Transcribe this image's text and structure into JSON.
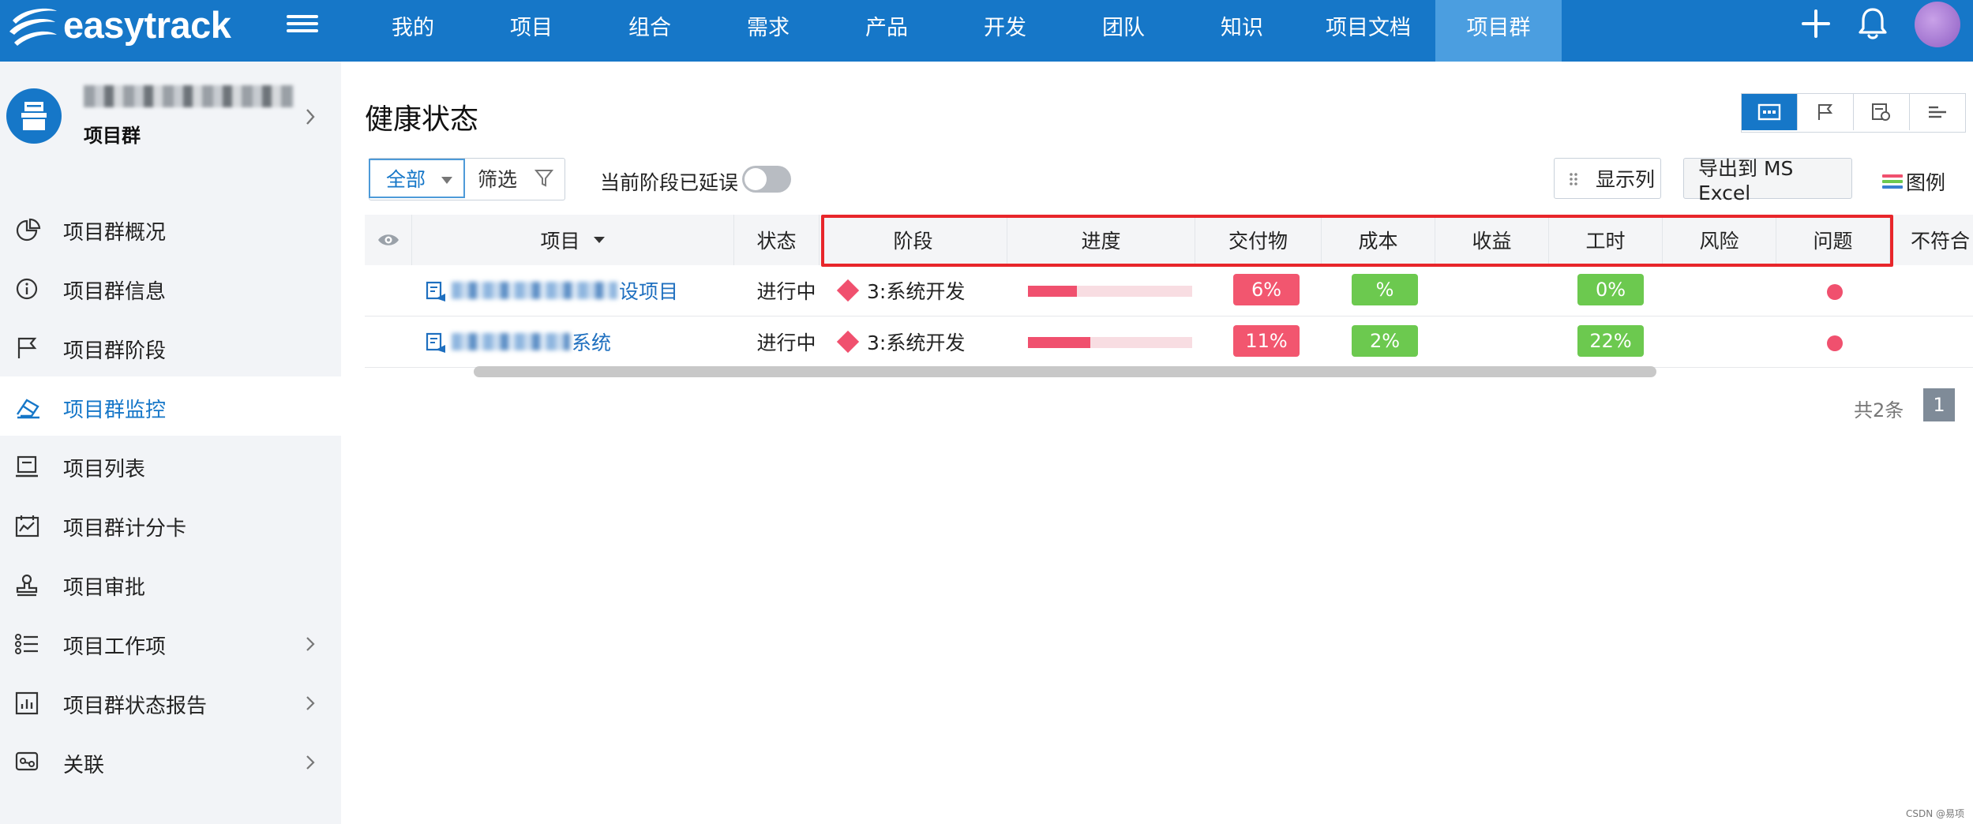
{
  "brand": {
    "name": "easytrack"
  },
  "nav": {
    "items": [
      {
        "label": "我的",
        "width": 150
      },
      {
        "label": "项目",
        "width": 150
      },
      {
        "label": "组合",
        "width": 150
      },
      {
        "label": "需求",
        "width": 150
      },
      {
        "label": "产品",
        "width": 150
      },
      {
        "label": "开发",
        "width": 150
      },
      {
        "label": "团队",
        "width": 150
      },
      {
        "label": "知识",
        "width": 150
      },
      {
        "label": "项目文档",
        "width": 170
      },
      {
        "label": "项目群",
        "width": 160
      }
    ],
    "active_label": "项目群"
  },
  "sidebar": {
    "group_name": "",
    "group_type": "项目群",
    "items": [
      {
        "label": "项目群概况"
      },
      {
        "label": "项目群信息"
      },
      {
        "label": "项目群阶段"
      },
      {
        "label": "项目群监控"
      },
      {
        "label": "项目列表"
      },
      {
        "label": "项目群计分卡"
      },
      {
        "label": "项目审批"
      },
      {
        "label": "项目工作项"
      },
      {
        "label": "项目群状态报告"
      },
      {
        "label": "关联"
      }
    ],
    "active_label": "项目群监控"
  },
  "main": {
    "title": "健康状态",
    "filter": {
      "scope": "全部",
      "filter_label": "筛选"
    },
    "delay_toggle_label": "当前阶段已延误",
    "delay_toggle_on": false,
    "show_columns_label": "显示列",
    "export_label": "导出到 MS Excel",
    "legend_label": "图例",
    "table": {
      "headers": {
        "project": "项目",
        "status": "状态",
        "stage": "阶段",
        "progress": "进度",
        "deliverable": "交付物",
        "cost": "成本",
        "revenue": "收益",
        "hours": "工时",
        "risk": "风险",
        "issue": "问题",
        "nonconform": "不符合"
      },
      "rows": [
        {
          "project_visible": "设项目",
          "status": "进行中",
          "stage": "3:系统开发",
          "progress": 0.3,
          "deliverable": "6%",
          "cost": "%",
          "hours": "0%",
          "issue_color": "#f0506e"
        },
        {
          "project_visible": "系统",
          "status": "进行中",
          "stage": "3:系统开发",
          "progress": 0.38,
          "deliverable": "11%",
          "cost": "2%",
          "hours": "22%",
          "issue_color": "#f0506e"
        }
      ]
    },
    "pager": {
      "total": "共2条",
      "page": "1"
    }
  },
  "colors": {
    "topbar": "#1677c8",
    "active_nav": "#4b9ee0",
    "red": "#f0506e",
    "green": "#6cc94f",
    "highlight_outline": "#e8262b"
  },
  "watermark": "CSDN @易项"
}
